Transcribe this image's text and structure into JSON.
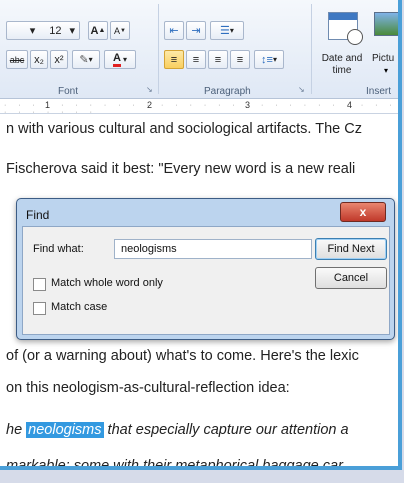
{
  "ribbon": {
    "font_size": "12",
    "font_group_label": "Font",
    "paragraph_group_label": "Paragraph",
    "insert_group_label": "Insert",
    "date_time_label_line1": "Date and",
    "date_time_label_line2": "time",
    "picture_label": "Pictu",
    "grow_font": "A",
    "shrink_font": "A",
    "strike": "abc",
    "subscript": "x₂",
    "superscript": "x²",
    "font_color": "A"
  },
  "ruler": {
    "ticks": [
      "1",
      "2",
      "3",
      "4"
    ]
  },
  "document": {
    "lines": [
      "n with various cultural and sociological artifacts. The Cz",
      "Fischerova said it best: \"Every new word is a new reali",
      "of (or a warning about) what's to come. Here's the lexic",
      "on this neologism-as-cultural-reflection idea:",
      "that especially capture our attention a",
      "markable: some with their metaphorical baggage car"
    ],
    "line5_prefix": "he",
    "highlighted_word": "neologisms"
  },
  "find_dialog": {
    "title": "Find",
    "close_symbol": "x",
    "find_what_label": "Find what:",
    "find_what_value": "neologisms",
    "find_next_label": "Find Next",
    "cancel_label": "Cancel",
    "match_whole_word_label": "Match whole word only",
    "match_case_label": "Match case"
  }
}
